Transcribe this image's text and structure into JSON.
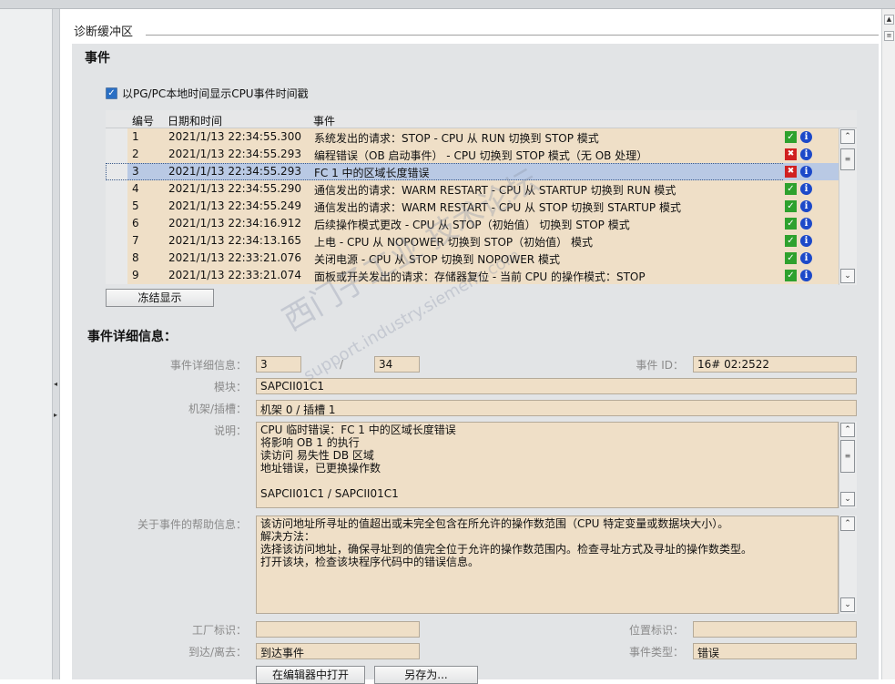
{
  "section": {
    "title": "诊断缓冲区"
  },
  "events": {
    "heading": "事件",
    "checkbox_label": "以PG/PC本地时间显示CPU事件时间戳",
    "columns": {
      "no": "编号",
      "datetime": "日期和时间",
      "event": "事件"
    },
    "rows": [
      {
        "no": "1",
        "datetime": "2021/1/13 22:34:55.300",
        "event": "系统发出的请求：STOP - CPU 从 RUN 切换到 STOP 模式",
        "status": "ok"
      },
      {
        "no": "2",
        "datetime": "2021/1/13 22:34:55.293",
        "event": "编程错误（OB 启动事件） - CPU 切换到 STOP 模式（无 OB 处理）",
        "status": "error"
      },
      {
        "no": "3",
        "datetime": "2021/1/13 22:34:55.293",
        "event": "FC 1 中的区域长度错误",
        "status": "error"
      },
      {
        "no": "4",
        "datetime": "2021/1/13 22:34:55.290",
        "event": "通信发出的请求：WARM RESTART - CPU 从 STARTUP 切换到 RUN 模式",
        "status": "ok"
      },
      {
        "no": "5",
        "datetime": "2021/1/13 22:34:55.249",
        "event": "通信发出的请求：WARM RESTART - CPU 从 STOP 切换到 STARTUP 模式",
        "status": "ok"
      },
      {
        "no": "6",
        "datetime": "2021/1/13 22:34:16.912",
        "event": "后续操作模式更改 - CPU 从 STOP（初始值） 切换到 STOP 模式",
        "status": "ok"
      },
      {
        "no": "7",
        "datetime": "2021/1/13 22:34:13.165",
        "event": "上电 - CPU 从 NOPOWER 切换到 STOP（初始值） 模式",
        "status": "ok"
      },
      {
        "no": "8",
        "datetime": "2021/1/13 22:33:21.076",
        "event": "关闭电源 - CPU 从 STOP 切换到 NOPOWER 模式",
        "status": "ok"
      },
      {
        "no": "9",
        "datetime": "2021/1/13 22:33:21.074",
        "event": "面板或开关发出的请求：存储器复位 - 当前 CPU 的操作模式：STOP",
        "status": "ok"
      }
    ],
    "selected_index": 2,
    "freeze_button": "冻结显示"
  },
  "details": {
    "heading": "事件详细信息：",
    "labels": {
      "detail_info": "事件详细信息：",
      "module": "模块：",
      "rack_slot": "机架/插槽：",
      "description": "说明：",
      "help": "关于事件的帮助信息：",
      "plant_id": "工厂标识：",
      "location_id": "位置标识：",
      "incoming_outgoing": "到达/离去：",
      "event_type": "事件类型：",
      "event_id": "事件 ID："
    },
    "current": "3",
    "separator": "/",
    "total": "34",
    "event_id": "16# 02:2522",
    "module": "SAPCII01C1",
    "rack_slot": "机架 0 / 插槽 1",
    "description_lines": [
      "CPU 临时错误：FC 1 中的区域长度错误",
      "将影响 OB 1 的执行",
      "读访问 易失性 DB 区域",
      "地址错误，已更换操作数",
      "",
      " SAPCII01C1 / SAPCII01C1"
    ],
    "help_lines": [
      "该访问地址所寻址的值超出或未完全包含在所允许的操作数范围（CPU 特定变量或数据块大小）。",
      "解决方法：",
      "选择该访问地址，确保寻址到的值完全位于允许的操作数范围内。检查寻址方式及寻址的操作数类型。",
      "打开该块，检查该块程序代码中的错误信息。"
    ],
    "plant_id": "",
    "location_id": "",
    "incoming_outgoing": "到达事件",
    "event_type": "错误",
    "open_editor_button": "在编辑器中打开",
    "save_as_button": "另存为..."
  },
  "watermark": {
    "line1": "西门子工业  技术论坛",
    "line2": "support.industry.siemens.com"
  },
  "colors": {
    "field_bg": "#efdfc7",
    "selected_row": "#b9c9e4",
    "ok_icon": "#2ea12e",
    "error_icon": "#d02020",
    "info_icon": "#1c49c9"
  }
}
